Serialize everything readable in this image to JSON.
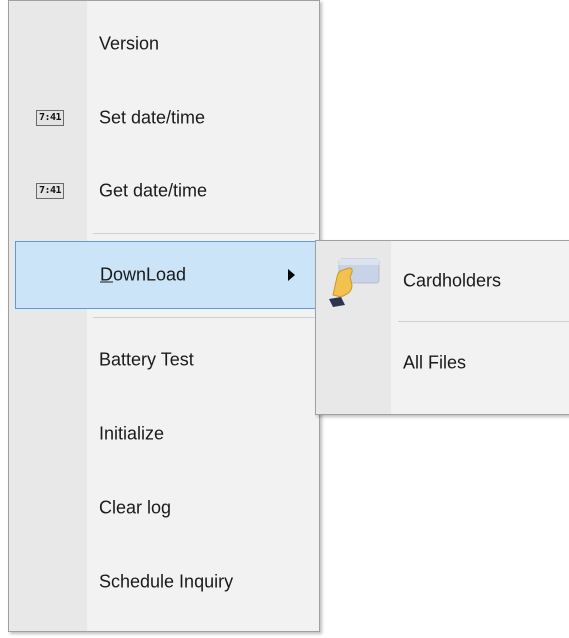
{
  "main_menu": {
    "items": [
      {
        "label": "Version"
      },
      {
        "label": "Set date/time",
        "icon": "clock-icon",
        "icon_text": "7:41"
      },
      {
        "label": "Get date/time",
        "icon": "clock-icon",
        "icon_text": "7:41"
      },
      {
        "label_accel": "D",
        "label_rest": "ownLoad",
        "highlighted": true,
        "submenu_arrow": "chevron-right-icon"
      },
      {
        "label": "Battery Test"
      },
      {
        "label": "Initialize"
      },
      {
        "label": "Clear log"
      },
      {
        "label": "Schedule Inquiry"
      }
    ]
  },
  "sub_menu": {
    "items": [
      {
        "label": "Cardholders",
        "icon": "card-hand-icon"
      },
      {
        "label": "All Files"
      }
    ]
  },
  "colors": {
    "menu_bg": "#f2f2f2",
    "gutter_bg": "#e8e8e8",
    "highlight_bg": "#cce4f7",
    "highlight_border": "#5a9cd8",
    "card_color": "#c9d3e6",
    "hand_color": "#f2c14e"
  }
}
